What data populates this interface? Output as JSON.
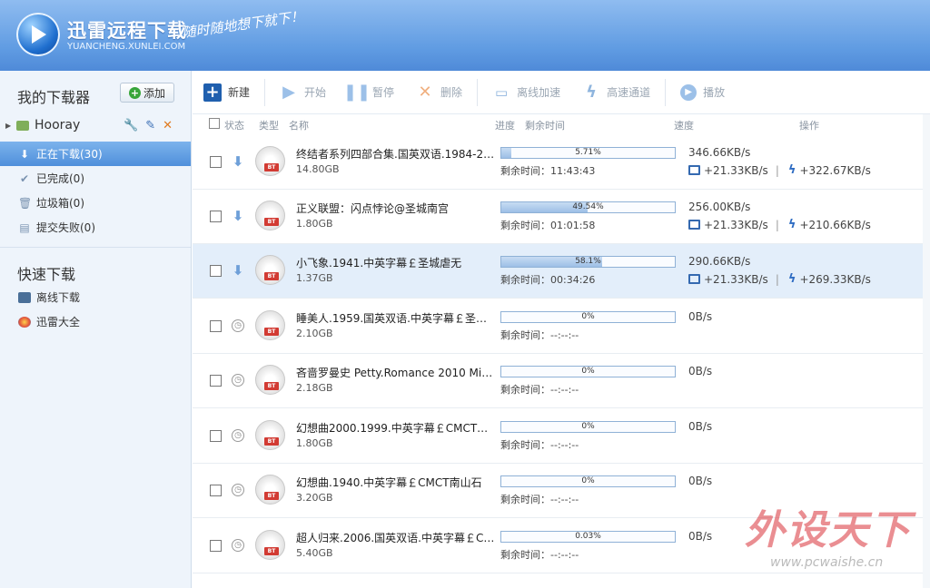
{
  "header": {
    "title": "迅雷远程下载",
    "url": "YUANCHENG.XUNLEI.COM",
    "slogan": "随时随地想下就下！"
  },
  "sidebar": {
    "heading": "我的下载器",
    "add_label": "添加",
    "user": "Hooray",
    "nav": [
      {
        "label": "正在下载(30)",
        "icon": "download-arrow-icon"
      },
      {
        "label": "已完成(0)",
        "icon": "check-icon"
      },
      {
        "label": "垃圾箱(0)",
        "icon": "trash-icon"
      },
      {
        "label": "提交失败(0)",
        "icon": "document-icon"
      }
    ],
    "quick_heading": "快速下载",
    "quick_items": [
      {
        "label": "离线下载",
        "icon": "offline-monitor-icon"
      },
      {
        "label": "迅雷大全",
        "icon": "globe-icon"
      }
    ]
  },
  "toolbar": {
    "new": "新建",
    "start": "开始",
    "pause": "暂停",
    "delete": "删除",
    "offline_accel": "离线加速",
    "highspeed": "高速通道",
    "play": "播放"
  },
  "columns": {
    "status": "状态",
    "type": "类型",
    "name": "名称",
    "progress": "进度",
    "remaining": "剩余时间",
    "speed": "速度",
    "actions": "操作"
  },
  "tasks": [
    {
      "name": "终结者系列四部合集.国英双语.1984-200...",
      "size": "14.80GB",
      "progress": 5.71,
      "pct": "5.71%",
      "remaining": "剩余时间：11:43:43",
      "speed": "346.66KB/s",
      "offline": "+21.33KB/s",
      "highspeed": "+322.67KB/s",
      "status": "downloading"
    },
    {
      "name": "正义联盟：闪点悖论@圣城南宫",
      "size": "1.80GB",
      "progress": 49.54,
      "pct": "49.54%",
      "remaining": "剩余时间：01:01:58",
      "speed": "256.00KB/s",
      "offline": "+21.33KB/s",
      "highspeed": "+210.66KB/s",
      "status": "downloading"
    },
    {
      "name": "小飞象.1941.中英字幕￡圣城虐无",
      "size": "1.37GB",
      "progress": 58.1,
      "pct": "58.1%",
      "remaining": "剩余时间：00:34:26",
      "speed": "290.66KB/s",
      "offline": "+21.33KB/s",
      "highspeed": "+269.33KB/s",
      "status": "downloading"
    },
    {
      "name": "睡美人.1959.国英双语.中英字幕￡圣城...",
      "size": "2.10GB",
      "progress": 0,
      "pct": "0%",
      "remaining": "剩余时间：--:--:--",
      "speed": "0B/s",
      "status": "waiting"
    },
    {
      "name": "吝啬罗曼史 Petty.Romance 2010 Mini...",
      "size": "2.18GB",
      "progress": 0,
      "pct": "0%",
      "remaining": "剩余时间：--:--:--",
      "speed": "0B/s",
      "status": "waiting"
    },
    {
      "name": "幻想曲2000.1999.中英字幕￡CMCT南...",
      "size": "1.80GB",
      "progress": 0,
      "pct": "0%",
      "remaining": "剩余时间：--:--:--",
      "speed": "0B/s",
      "status": "waiting"
    },
    {
      "name": "幻想曲.1940.中英字幕￡CMCT南山石",
      "size": "3.20GB",
      "progress": 0,
      "pct": "0%",
      "remaining": "剩余时间：--:--:--",
      "speed": "0B/s",
      "status": "waiting"
    },
    {
      "name": "超人归来.2006.国英双语.中英字幕￡CM...",
      "size": "5.40GB",
      "progress": 0.03,
      "pct": "0.03%",
      "remaining": "剩余时间：--:--:--",
      "speed": "0B/s",
      "status": "waiting"
    }
  ],
  "watermark": {
    "brand": "外设天下",
    "url": "www.pcwaishe.cn"
  },
  "colors": {
    "accent": "#5f9be2",
    "selected_row": "#e3eefa",
    "bt_badge": "#d23b33"
  }
}
